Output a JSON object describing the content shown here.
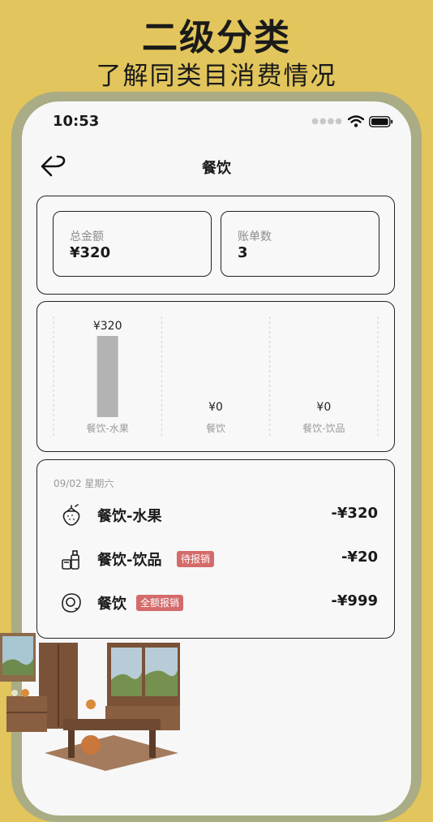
{
  "promo": {
    "headline": "二级分类",
    "subheadline": "了解同类目消费情况"
  },
  "status_bar": {
    "time": "10:53"
  },
  "nav": {
    "title": "餐饮"
  },
  "summary": {
    "total_label": "总金额",
    "total_value": "¥320",
    "count_label": "账单数",
    "count_value": "3"
  },
  "chart_data": {
    "type": "bar",
    "categories": [
      "餐饮-水果",
      "餐饮",
      "餐饮-饮品"
    ],
    "values": [
      320,
      0,
      0
    ],
    "value_labels": [
      "¥320",
      "¥0",
      "¥0"
    ],
    "grid": "vertical-dashed",
    "bar_color": "#B3B3B3"
  },
  "transactions": {
    "date": "09/02 星期六",
    "items": [
      {
        "icon": "strawberry-icon",
        "name": "餐饮-水果",
        "badge": "",
        "amount": "-¥320"
      },
      {
        "icon": "drinks-icon",
        "name": "餐饮-饮品",
        "badge": "待报销",
        "amount": "-¥20"
      },
      {
        "icon": "fried-egg-icon",
        "name": "餐饮",
        "badge": "全额报销",
        "amount": "-¥999"
      }
    ]
  },
  "colors": {
    "background": "#E2C55C",
    "phone_frame": "#A9AC84",
    "badge": "#D46A6A"
  }
}
